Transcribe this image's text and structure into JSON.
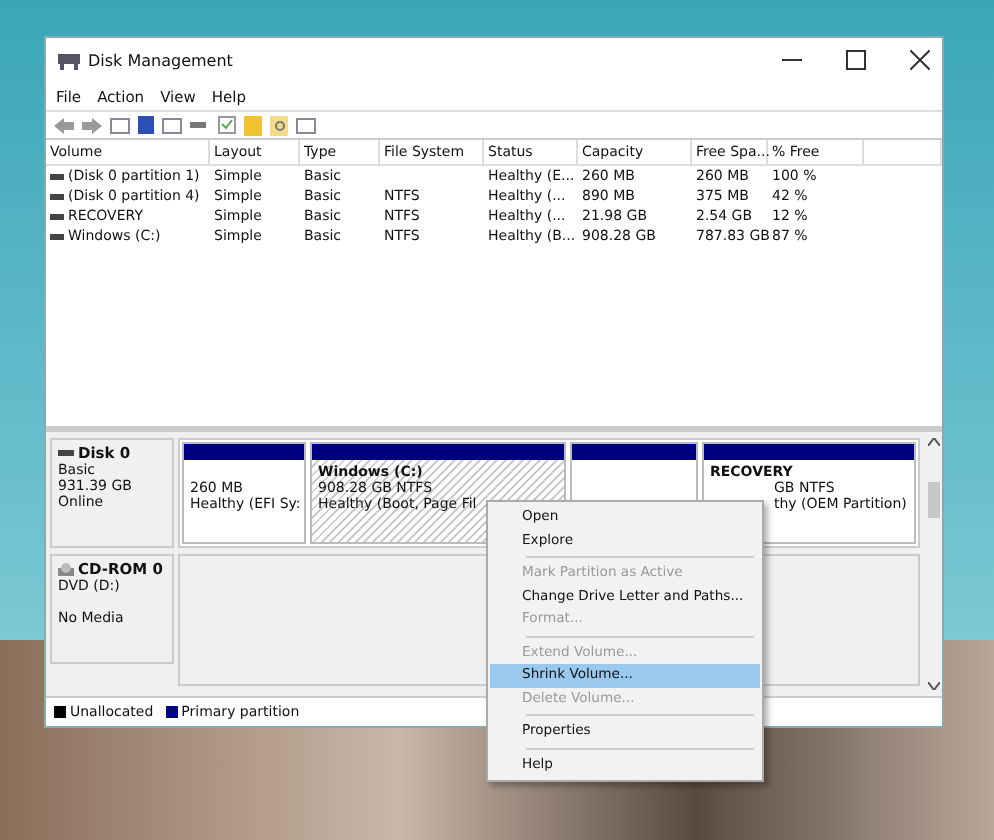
{
  "window": {
    "title": "Disk Management"
  },
  "menu_bar": [
    "File",
    "Action",
    "View",
    "Help"
  ],
  "volume_table": {
    "columns": [
      "Volume",
      "Layout",
      "Type",
      "File System",
      "Status",
      "Capacity",
      "Free Spa...",
      "% Free"
    ],
    "rows": [
      {
        "cells": [
          "(Disk 0 partition 1)",
          "Simple",
          "Basic",
          "",
          "Healthy (E...",
          "260 MB",
          "260 MB",
          "100 %"
        ]
      },
      {
        "cells": [
          "(Disk 0 partition 4)",
          "Simple",
          "Basic",
          "NTFS",
          "Healthy (...",
          "890 MB",
          "375 MB",
          "42 %"
        ]
      },
      {
        "cells": [
          "RECOVERY",
          "Simple",
          "Basic",
          "NTFS",
          "Healthy (...",
          "21.98 GB",
          "2.54 GB",
          "12 %"
        ]
      },
      {
        "cells": [
          "Windows (C:)",
          "Simple",
          "Basic",
          "NTFS",
          "Healthy (B...",
          "908.28 GB",
          "787.83 GB",
          "87 %"
        ]
      }
    ]
  },
  "disks": [
    {
      "kind": "disk",
      "name": "Disk 0",
      "type": "Basic",
      "size": "931.39 GB",
      "status": "Online",
      "partitions": [
        {
          "selected": false,
          "color": "#000080",
          "size": "260 MB",
          "status": "Healthy (EFI Sy:"
        },
        {
          "selected": true,
          "color": "#000080",
          "label": "Windows  (C:)",
          "size": "908.28 GB NTFS",
          "status": "Healthy (Boot, Page Fil"
        },
        {
          "selected": false,
          "color": "#000080"
        },
        {
          "selected": false,
          "color": "#000080",
          "label": "RECOVERY",
          "size": "GB NTFS",
          "status": "thy (OEM Partition)"
        }
      ]
    },
    {
      "kind": "cdrom",
      "name": "CD-ROM 0",
      "type": "DVD (D:)",
      "status": "No Media"
    }
  ],
  "legend": [
    {
      "label": "Unallocated",
      "color": "#000000"
    },
    {
      "label": "Primary partition",
      "color": "#000080"
    }
  ],
  "context_menu": [
    {
      "kind": "item",
      "label": "Open",
      "disabled": false,
      "selected": false
    },
    {
      "kind": "item",
      "label": "Explore",
      "disabled": false,
      "selected": false
    },
    {
      "kind": "separator"
    },
    {
      "kind": "item",
      "label": "Mark Partition as Active",
      "disabled": true,
      "selected": false
    },
    {
      "kind": "item",
      "label": "Change Drive Letter and Paths...",
      "disabled": false,
      "selected": false
    },
    {
      "kind": "item",
      "label": "Format...",
      "disabled": true,
      "selected": false
    },
    {
      "kind": "separator"
    },
    {
      "kind": "item",
      "label": "Extend Volume...",
      "disabled": true,
      "selected": false
    },
    {
      "kind": "item",
      "label": "Shrink Volume...",
      "disabled": false,
      "selected": true
    },
    {
      "kind": "item",
      "label": "Delete Volume...",
      "disabled": true,
      "selected": false
    },
    {
      "kind": "separator"
    },
    {
      "kind": "item",
      "label": "Properties",
      "disabled": false,
      "selected": false
    },
    {
      "kind": "separator"
    },
    {
      "kind": "item",
      "label": "Help",
      "disabled": false,
      "selected": false
    }
  ]
}
